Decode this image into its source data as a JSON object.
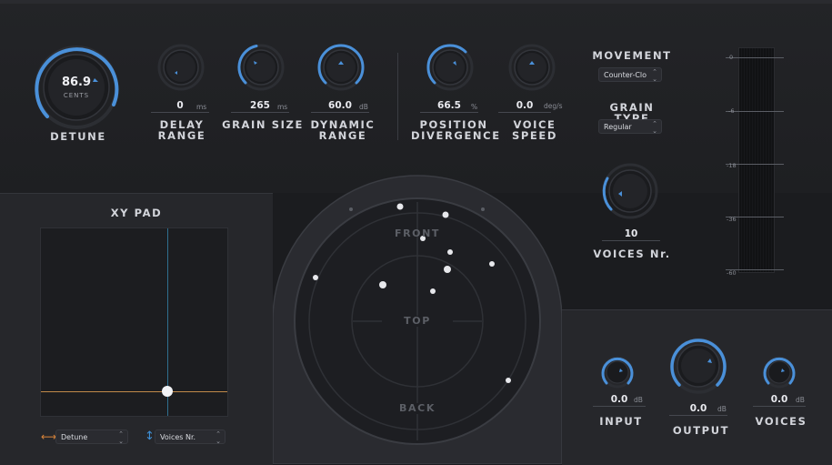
{
  "knobs": {
    "detune": {
      "value": "86.9",
      "unit": "CENTS",
      "label": "DETUNE"
    },
    "delay_range": {
      "value": "0",
      "unit": "ms",
      "label_l1": "DELAY",
      "label_l2": "RANGE"
    },
    "grain_size": {
      "value": "265",
      "unit": "ms",
      "label": "GRAIN SIZE"
    },
    "dynamic_range": {
      "value": "60.0",
      "unit": "dB",
      "label_l1": "DYNAMIC",
      "label_l2": "RANGE"
    },
    "position_divergence": {
      "value": "66.5",
      "unit": "%",
      "label_l1": "POSITION",
      "label_l2": "DIVERGENCE"
    },
    "voice_speed": {
      "value": "0.0",
      "unit": "deg/s",
      "label_l1": "VOICE",
      "label_l2": "SPEED"
    },
    "voices_nr": {
      "value": "10",
      "label": "VOICES Nr."
    },
    "input": {
      "value": "0.0",
      "unit": "dB",
      "label": "INPUT"
    },
    "output": {
      "value": "0.0",
      "unit": "dB",
      "label": "OUTPUT"
    },
    "voices": {
      "value": "0.0",
      "unit": "dB",
      "label": "VOICES"
    }
  },
  "movement": {
    "label": "MOVEMENT",
    "selected": "Counter-Clo"
  },
  "grain_type": {
    "label": "GRAIN TYPE",
    "selected": "Regular"
  },
  "xy_pad": {
    "title": "XY PAD",
    "x_param": "Detune",
    "y_param": "Voices Nr."
  },
  "spatial": {
    "front": "FRONT",
    "top": "TOP",
    "back": "BACK"
  },
  "meter": {
    "scale": [
      "0",
      "-6",
      "-18",
      "-36",
      "-60"
    ]
  },
  "colors": {
    "accent": "#4a90d9",
    "crosshair_h": "#c08a4a",
    "crosshair_v": "#2f6f8f"
  }
}
